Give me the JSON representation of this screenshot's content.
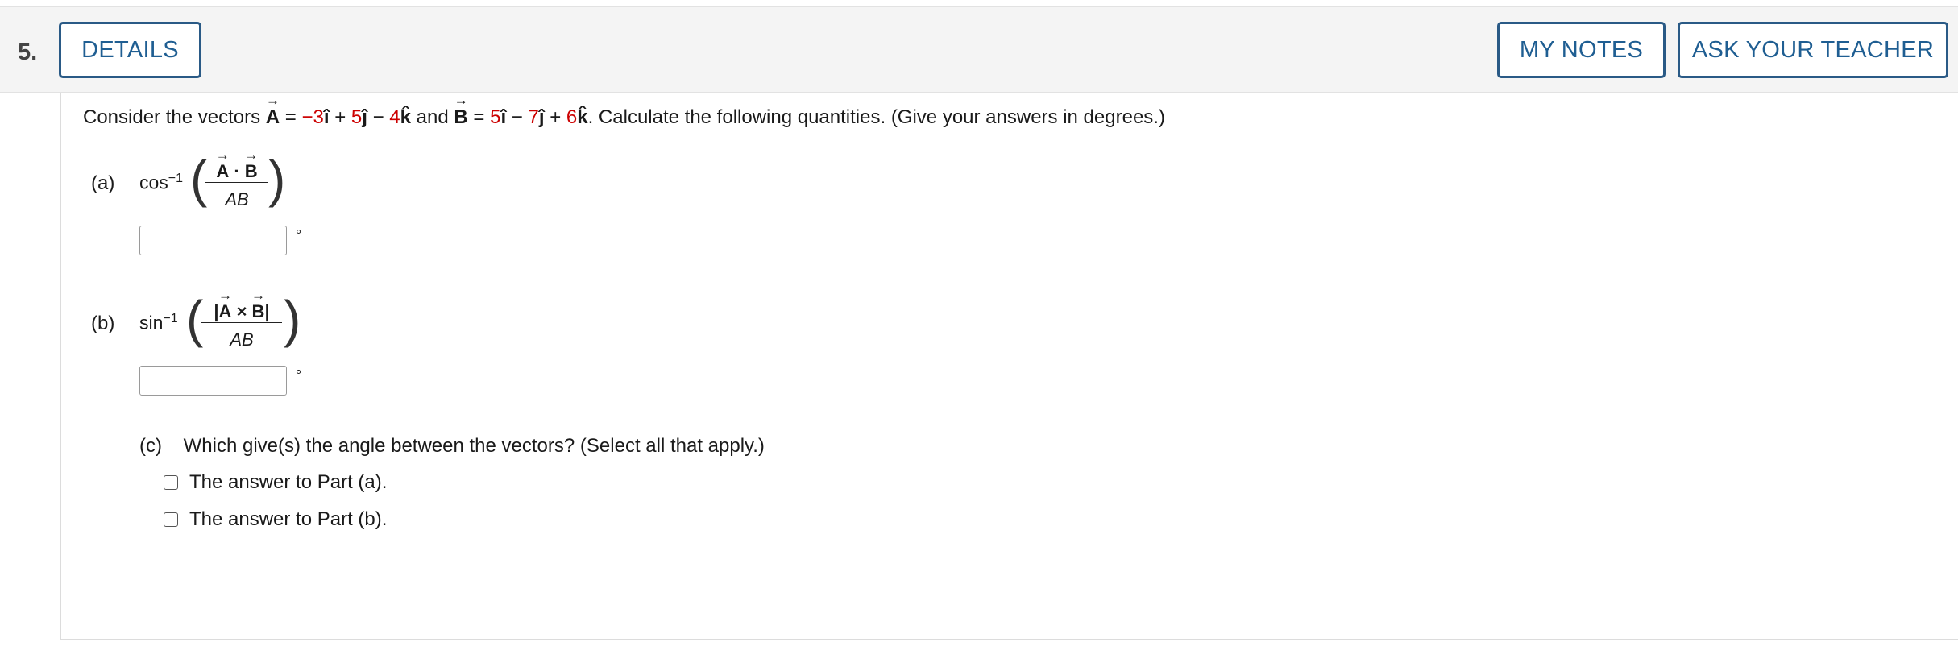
{
  "question": {
    "number": "5.",
    "details_label": "DETAILS",
    "my_notes_label": "MY NOTES",
    "ask_teacher_label": "ASK YOUR TEACHER"
  },
  "prompt": {
    "prefix": "Consider the vectors",
    "A": "A",
    "eq": "=",
    "a1": "−3",
    "i": "î",
    "plus": "+",
    "a2": "5",
    "j": "ĵ",
    "minus": "−",
    "a3": "4",
    "k": "k̂",
    "and": "and",
    "B": "B",
    "b1": "5",
    "b2": "7",
    "b3": "6",
    "suffix": ". Calculate the following quantities. (Give your answers in degrees.)"
  },
  "part_a": {
    "label": "(a)",
    "function": "cos",
    "exponent": "−1",
    "numerator_A": "A",
    "numerator_op": "·",
    "numerator_B": "B",
    "denominator": "AB",
    "answer": "",
    "unit": "°"
  },
  "part_b": {
    "label": "(b)",
    "function": "sin",
    "exponent": "−1",
    "bar_left": "|",
    "numerator_A": "A",
    "numerator_op": "×",
    "numerator_B": "B",
    "bar_right": "|",
    "denominator": "AB",
    "answer": "",
    "unit": "°"
  },
  "part_c": {
    "label": "(c)",
    "question": "Which give(s) the angle between the vectors? (Select all that apply.)",
    "options": [
      {
        "label": "The answer to Part (a).",
        "checked": false
      },
      {
        "label": "The answer to Part (b).",
        "checked": false
      }
    ]
  }
}
